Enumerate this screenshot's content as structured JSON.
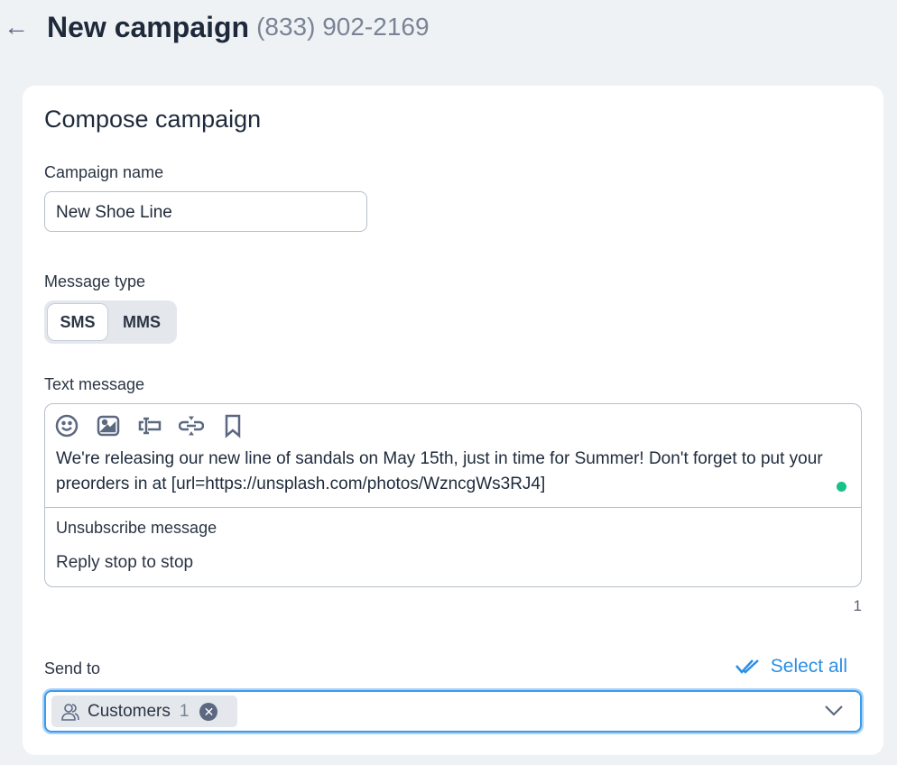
{
  "header": {
    "title": "New campaign",
    "phone": "(833) 902-2169"
  },
  "card": {
    "title": "Compose campaign",
    "campaign_name": {
      "label": "Campaign name",
      "value": "New Shoe Line"
    },
    "message_type": {
      "label": "Message type",
      "options": [
        "SMS",
        "MMS"
      ],
      "selected": "SMS"
    },
    "text_message": {
      "label": "Text message",
      "body": "We're releasing our new line of sandals on May 15th, just in time for Summer! Don't forget to put your preorders in at [url=https://unsplash.com/photos/WzncgWs3RJ4]",
      "unsubscribe_label": "Unsubscribe message",
      "unsubscribe_value": "Reply stop to stop",
      "segment_count": "1"
    },
    "send_to": {
      "label": "Send to",
      "select_all": "Select all",
      "chip_label": "Customers",
      "chip_count": "1"
    }
  },
  "colors": {
    "accent": "#2b8fe6",
    "status_dot": "#19c08a"
  }
}
